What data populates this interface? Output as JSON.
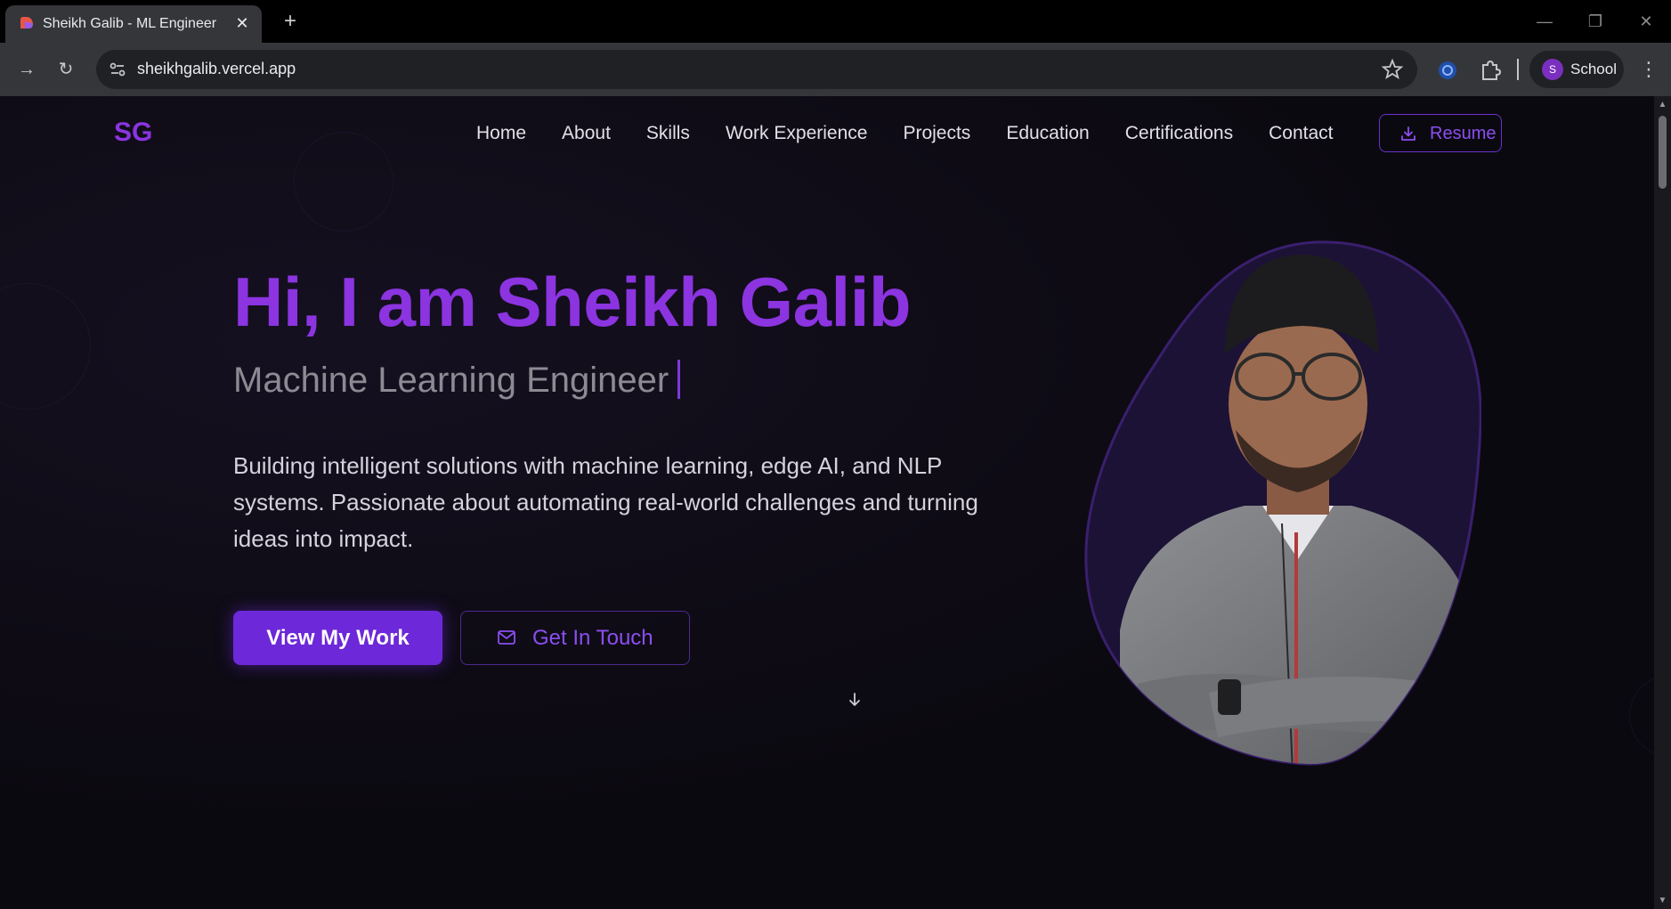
{
  "browser": {
    "tab_title": "Sheikh Galib - ML Engineer",
    "url": "sheikhgalib.vercel.app",
    "profile_initial": "S",
    "profile_label": "School"
  },
  "site": {
    "logo": "SG",
    "nav": [
      "Home",
      "About",
      "Skills",
      "Work Experience",
      "Projects",
      "Education",
      "Certifications",
      "Contact"
    ],
    "resume_label": "Resume"
  },
  "hero": {
    "title": "Hi, I am Sheikh Galib",
    "subtitle": "Machine Learning Engineer",
    "description": "Building intelligent solutions with machine learning, edge AI, and NLP systems. Passionate about automating real-world challenges and turning ideas into impact.",
    "primary_button": "View My Work",
    "secondary_button": "Get In Touch"
  },
  "colors": {
    "accent": "#8b34e0",
    "button": "#6d28d9",
    "background": "#0b0910"
  }
}
